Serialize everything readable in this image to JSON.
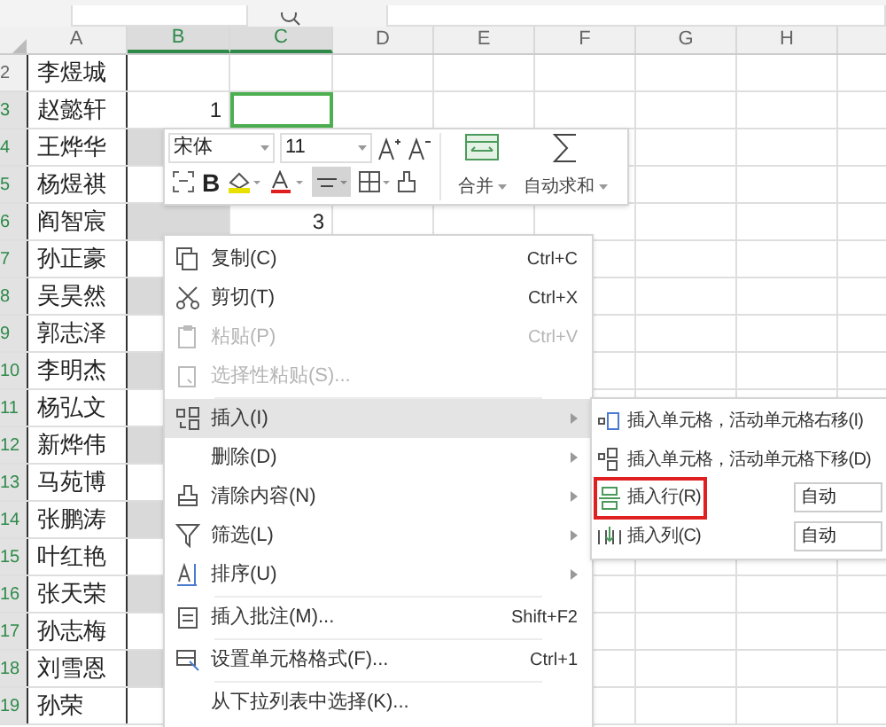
{
  "columns": [
    {
      "label": "A",
      "selected": false
    },
    {
      "label": "B",
      "selected": true
    },
    {
      "label": "C",
      "selected": true
    },
    {
      "label": "D",
      "selected": false
    },
    {
      "label": "E",
      "selected": false
    },
    {
      "label": "F",
      "selected": false
    },
    {
      "label": "G",
      "selected": false
    },
    {
      "label": "H",
      "selected": false
    }
  ],
  "rows": [
    {
      "num": "2",
      "name": "李煜城",
      "selected": false,
      "shaded": false
    },
    {
      "num": "3",
      "name": "赵懿轩",
      "b": "1",
      "selected": true,
      "shaded": false,
      "c_active": true
    },
    {
      "num": "4",
      "name": "王烨华",
      "selected": true,
      "shaded": true
    },
    {
      "num": "5",
      "name": "杨煜祺",
      "selected": true,
      "shaded": false
    },
    {
      "num": "6",
      "name": "阎智宸",
      "c": "3",
      "selected": true,
      "shaded": true
    },
    {
      "num": "7",
      "name": "孙正豪",
      "selected": true,
      "shaded": false
    },
    {
      "num": "8",
      "name": "吴昊然",
      "selected": true,
      "shaded": true
    },
    {
      "num": "9",
      "name": "郭志泽",
      "selected": true,
      "shaded": false
    },
    {
      "num": "10",
      "name": "李明杰",
      "selected": true,
      "shaded": true
    },
    {
      "num": "11",
      "name": "杨弘文",
      "selected": true,
      "shaded": false
    },
    {
      "num": "12",
      "name": "新烨伟",
      "selected": true,
      "shaded": true
    },
    {
      "num": "13",
      "name": "马苑博",
      "selected": true,
      "shaded": false
    },
    {
      "num": "14",
      "name": "张鹏涛",
      "selected": true,
      "shaded": true
    },
    {
      "num": "15",
      "name": "叶红艳",
      "selected": true,
      "shaded": false
    },
    {
      "num": "16",
      "name": "张天荣",
      "selected": true,
      "shaded": true
    },
    {
      "num": "17",
      "name": "孙志梅",
      "selected": true,
      "shaded": false
    },
    {
      "num": "18",
      "name": "刘雪恩",
      "selected": true,
      "shaded": true
    },
    {
      "num": "19",
      "name": "孙荣",
      "selected": true,
      "shaded": false
    }
  ],
  "toolbar": {
    "font": "宋体",
    "size": "11",
    "bold": "B",
    "merge": "合并",
    "autosum": "自动求和",
    "align_selected": true
  },
  "context_menu": [
    {
      "kind": "item",
      "label": "复制(C)",
      "shortcut": "Ctrl+C",
      "disabled": false,
      "selected": false,
      "submenu": false
    },
    {
      "kind": "item",
      "label": "剪切(T)",
      "shortcut": "Ctrl+X",
      "disabled": false,
      "selected": false,
      "submenu": false
    },
    {
      "kind": "item",
      "label": "粘贴(P)",
      "shortcut": "Ctrl+V",
      "disabled": true,
      "selected": false,
      "submenu": false
    },
    {
      "kind": "item",
      "label": "选择性粘贴(S)...",
      "disabled": true,
      "selected": false,
      "submenu": false
    },
    {
      "kind": "separator"
    },
    {
      "kind": "item",
      "label": "插入(I)",
      "disabled": false,
      "selected": true,
      "submenu": true
    },
    {
      "kind": "item",
      "label": "删除(D)",
      "disabled": false,
      "selected": false,
      "submenu": true
    },
    {
      "kind": "item",
      "label": "清除内容(N)",
      "disabled": false,
      "selected": false,
      "submenu": true
    },
    {
      "kind": "item",
      "label": "筛选(L)",
      "disabled": false,
      "selected": false,
      "submenu": true
    },
    {
      "kind": "item",
      "label": "排序(U)",
      "disabled": false,
      "selected": false,
      "submenu": true
    },
    {
      "kind": "separator"
    },
    {
      "kind": "item",
      "label": "插入批注(M)...",
      "shortcut": "Shift+F2",
      "disabled": false,
      "selected": false,
      "submenu": false
    },
    {
      "kind": "separator"
    },
    {
      "kind": "item",
      "label": "设置单元格格式(F)...",
      "shortcut": "Ctrl+1",
      "disabled": false,
      "selected": false,
      "submenu": false
    },
    {
      "kind": "separator"
    },
    {
      "kind": "item",
      "label": "从下拉列表中选择(K)...",
      "disabled": false,
      "selected": false,
      "submenu": false
    }
  ],
  "submenu": [
    {
      "label": "插入单元格，活动单元格右移(I)",
      "highlighted": false
    },
    {
      "label": "插入单元格，活动单元格下移(D)",
      "highlighted": false
    },
    {
      "label": "插入行(R)",
      "value": "自动",
      "highlighted": true
    },
    {
      "label": "插入列(C)",
      "value": "自动",
      "highlighted": false
    }
  ]
}
